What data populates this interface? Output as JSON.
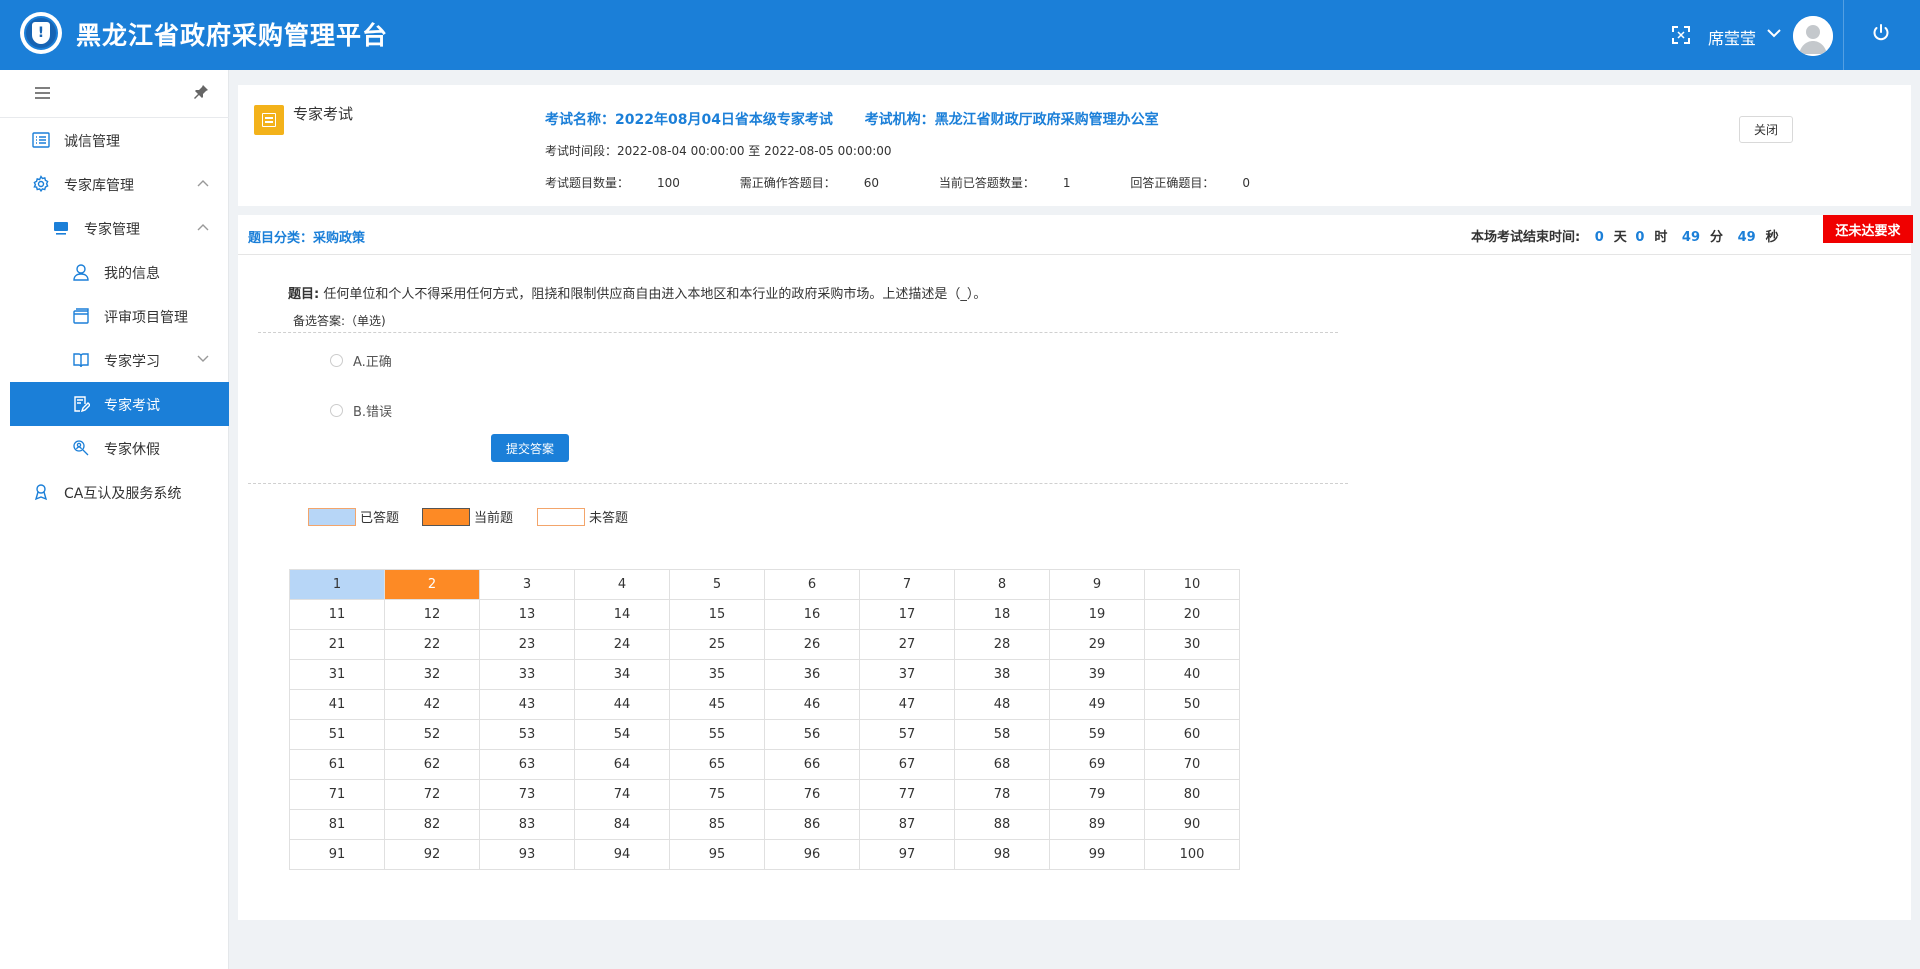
{
  "header": {
    "app_title": "黑龙江省政府采购管理平台",
    "user_name": "席莹莹"
  },
  "sidebar": {
    "items": [
      {
        "label": "诚信管理"
      },
      {
        "label": "专家库管理"
      },
      {
        "label": "专家管理"
      },
      {
        "label": "我的信息"
      },
      {
        "label": "评审项目管理"
      },
      {
        "label": "专家学习"
      },
      {
        "label": "专家考试"
      },
      {
        "label": "专家休假"
      },
      {
        "label": "CA互认及服务系统"
      }
    ]
  },
  "exam": {
    "panel_title": "专家考试",
    "name_label": "考试名称：",
    "name_value": "2022年08月04日省本级专家考试",
    "org_label": "考试机构：",
    "org_value": "黑龙江省财政厅政府采购管理办公室",
    "period_label": "考试时间段：",
    "period_value": "2022-08-04 00:00:00 至 2022-08-05 00:00:00",
    "total_label": "考试题目数量：",
    "total_value": "100",
    "required_label": "需正确作答题目：",
    "required_value": "60",
    "answered_label": "当前已答题数量：",
    "answered_value": "1",
    "correct_label": "回答正确题目：",
    "correct_value": "0",
    "close_label": "关闭"
  },
  "category": {
    "label": "题目分类：",
    "value": "采购政策"
  },
  "timer": {
    "label": "本场考试结束时间:",
    "days": "0",
    "days_unit": "天",
    "hours": "0",
    "hours_unit": "时",
    "minutes": "49",
    "minutes_unit": "分",
    "seconds": "49",
    "seconds_unit": "秒",
    "warning": "还未达要求"
  },
  "question": {
    "label": "题目:",
    "text": "任何单位和个人不得采用任何方式，阻挠和限制供应商自由进入本地区和本行业的政府采购市场。上述描述是（_）。",
    "answers_label": "备选答案:（单选)",
    "options": [
      "A.正确",
      "B.错误"
    ],
    "submit_label": "提交答案"
  },
  "legend": {
    "answered": "已答题",
    "current": "当前题",
    "unanswered": "未答题",
    "answered_color": "#b7d6f7",
    "current_color": "#fd8a25",
    "unanswered_color": "#ffffff",
    "border_color": "#f3a56b"
  },
  "grid": {
    "answered": [
      1
    ],
    "current": 2,
    "rows": [
      [
        "1",
        "2",
        "3",
        "4",
        "5",
        "6",
        "7",
        "8",
        "9",
        "10"
      ],
      [
        "11",
        "12",
        "13",
        "14",
        "15",
        "16",
        "17",
        "18",
        "19",
        "20"
      ],
      [
        "21",
        "22",
        "23",
        "24",
        "25",
        "26",
        "27",
        "28",
        "29",
        "30"
      ],
      [
        "31",
        "32",
        "33",
        "34",
        "35",
        "36",
        "37",
        "38",
        "39",
        "40"
      ],
      [
        "41",
        "42",
        "43",
        "44",
        "45",
        "46",
        "47",
        "48",
        "49",
        "50"
      ],
      [
        "51",
        "52",
        "53",
        "54",
        "55",
        "56",
        "57",
        "58",
        "59",
        "60"
      ],
      [
        "61",
        "62",
        "63",
        "64",
        "65",
        "66",
        "67",
        "68",
        "69",
        "70"
      ],
      [
        "71",
        "72",
        "73",
        "74",
        "75",
        "76",
        "77",
        "78",
        "79",
        "80"
      ],
      [
        "81",
        "82",
        "83",
        "84",
        "85",
        "86",
        "87",
        "88",
        "89",
        "90"
      ],
      [
        "91",
        "92",
        "93",
        "94",
        "95",
        "96",
        "97",
        "98",
        "99",
        "100"
      ]
    ]
  }
}
